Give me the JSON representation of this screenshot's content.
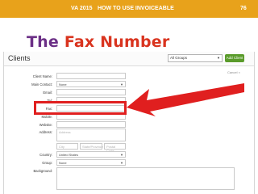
{
  "header": {
    "left": "VA 2015",
    "title": "HOW TO USE INVOICEABLE",
    "page": "76",
    "bar_color": "#e8a21b"
  },
  "slide": {
    "title_the": "The",
    "title_rest": "Fax Number"
  },
  "screenshot": {
    "panel_title": "Clients",
    "group_select": "All Groups",
    "add_client_label": "Add Client",
    "cancel_link": "Cancel ×",
    "form": {
      "client_name_label": "Client Name:",
      "main_contact_label": "Main Contact:",
      "main_contact_value": "None",
      "email_label": "Email:",
      "tel_label": "Tel:",
      "fax_label": "Fax:",
      "mobile_label": "Mobile:",
      "website_label": "Website:",
      "address_label": "Address:",
      "address_placeholder": "Address",
      "city_placeholder": "City",
      "state_placeholder": "State/Province",
      "postal_placeholder": "Postal Code",
      "country_label": "Country:",
      "country_value": "United States",
      "group_label": "Group:",
      "group_value": "None",
      "background_label": "Background:"
    }
  },
  "colors": {
    "title_the": "#6b2f86",
    "title_rest": "#d9341f",
    "highlight": "#e01f1f",
    "add_button": "#5a9b2b"
  }
}
